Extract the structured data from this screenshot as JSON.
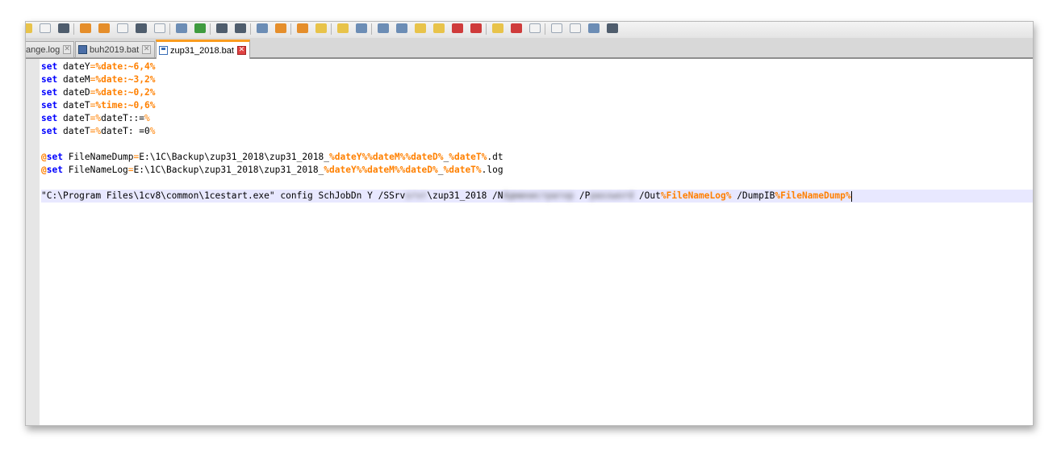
{
  "tabs": [
    {
      "label": "ange.log",
      "active": false,
      "unsaved": false
    },
    {
      "label": "buh2019.bat",
      "active": false,
      "unsaved": false
    },
    {
      "label": "zup31_2018.bat",
      "active": true,
      "unsaved": true
    }
  ],
  "toolbar_icons": [
    "new-file-icon",
    "open-file-icon",
    "save-icon",
    "save-all-icon",
    "close-icon",
    "close-all-icon",
    "print-icon",
    "cut-icon",
    "copy-icon",
    "paste-icon",
    "undo-icon",
    "redo-icon",
    "find-icon",
    "replace-icon",
    "zoom-in-icon",
    "zoom-out-icon",
    "sync-vertical-icon",
    "sync-horizontal-icon",
    "word-wrap-icon",
    "show-all-chars-icon",
    "indent-guide-icon",
    "user-language-icon",
    "doc-map-icon",
    "function-list-icon",
    "folder-workspace-icon",
    "monitoring-icon",
    "record-macro-icon",
    "stop-macro-icon",
    "play-macro-icon",
    "run-macro-icon",
    "save-macro-icon"
  ],
  "code": {
    "l1": {
      "kw": "set",
      "a": " dateY",
      "op": "=",
      "b": "%date:~6,4%"
    },
    "l2": {
      "kw": "set",
      "a": " dateM",
      "op": "=",
      "b": "%date:~3,2%"
    },
    "l3": {
      "kw": "set",
      "a": " dateD",
      "op": "=",
      "b": "%date:~0,2%"
    },
    "l4": {
      "kw": "set",
      "a": " dateT",
      "op": "=",
      "b": "%time:~0,6%"
    },
    "l5": {
      "kw": "set",
      "a": " dateT",
      "op": "=",
      "p": "%",
      "c": "dateT::=",
      "p2": "%"
    },
    "l6": {
      "kw": "set",
      "a": " dateT",
      "op": "=",
      "p": "%",
      "c": "dateT: =0",
      "p2": "%"
    },
    "l8": {
      "at": "@",
      "kw": "set",
      "a": " FileNameDump",
      "op": "=",
      "c": "E:\\1C\\Backup\\zup31_2018\\zup31_2018_",
      "v1": "%dateY%%dateM%%dateD%",
      "c2": "_",
      "v2": "%dateT%",
      "c3": ".dt"
    },
    "l9": {
      "at": "@",
      "kw": "set",
      "a": " FileNameLog",
      "op": "=",
      "c": "E:\\1C\\Backup\\zup31_2018\\zup31_2018_",
      "v1": "%dateY%%dateM%%dateD%",
      "c2": "_",
      "v2": "%dateT%",
      "c3": ".log"
    },
    "l11": {
      "a": "\"C:\\Program Files\\1cv8\\common\\1cestart.exe\" config SchJobDn Y /SSrv",
      "blur1": "srvr",
      "b": "\\zup31_2018 /N",
      "blur2": "Администратор",
      "c": " /P",
      "blur3": "password",
      "d": " /Out",
      "v1": "%FileNameLog%",
      "e": " /DumpIB",
      "v2": "%FileNameDump%"
    }
  },
  "colors": {
    "keyword": "#0000ff",
    "operator": "#ff8000",
    "active_tab_accent": "#fa9c1f",
    "current_line": "#e8e8ff"
  }
}
